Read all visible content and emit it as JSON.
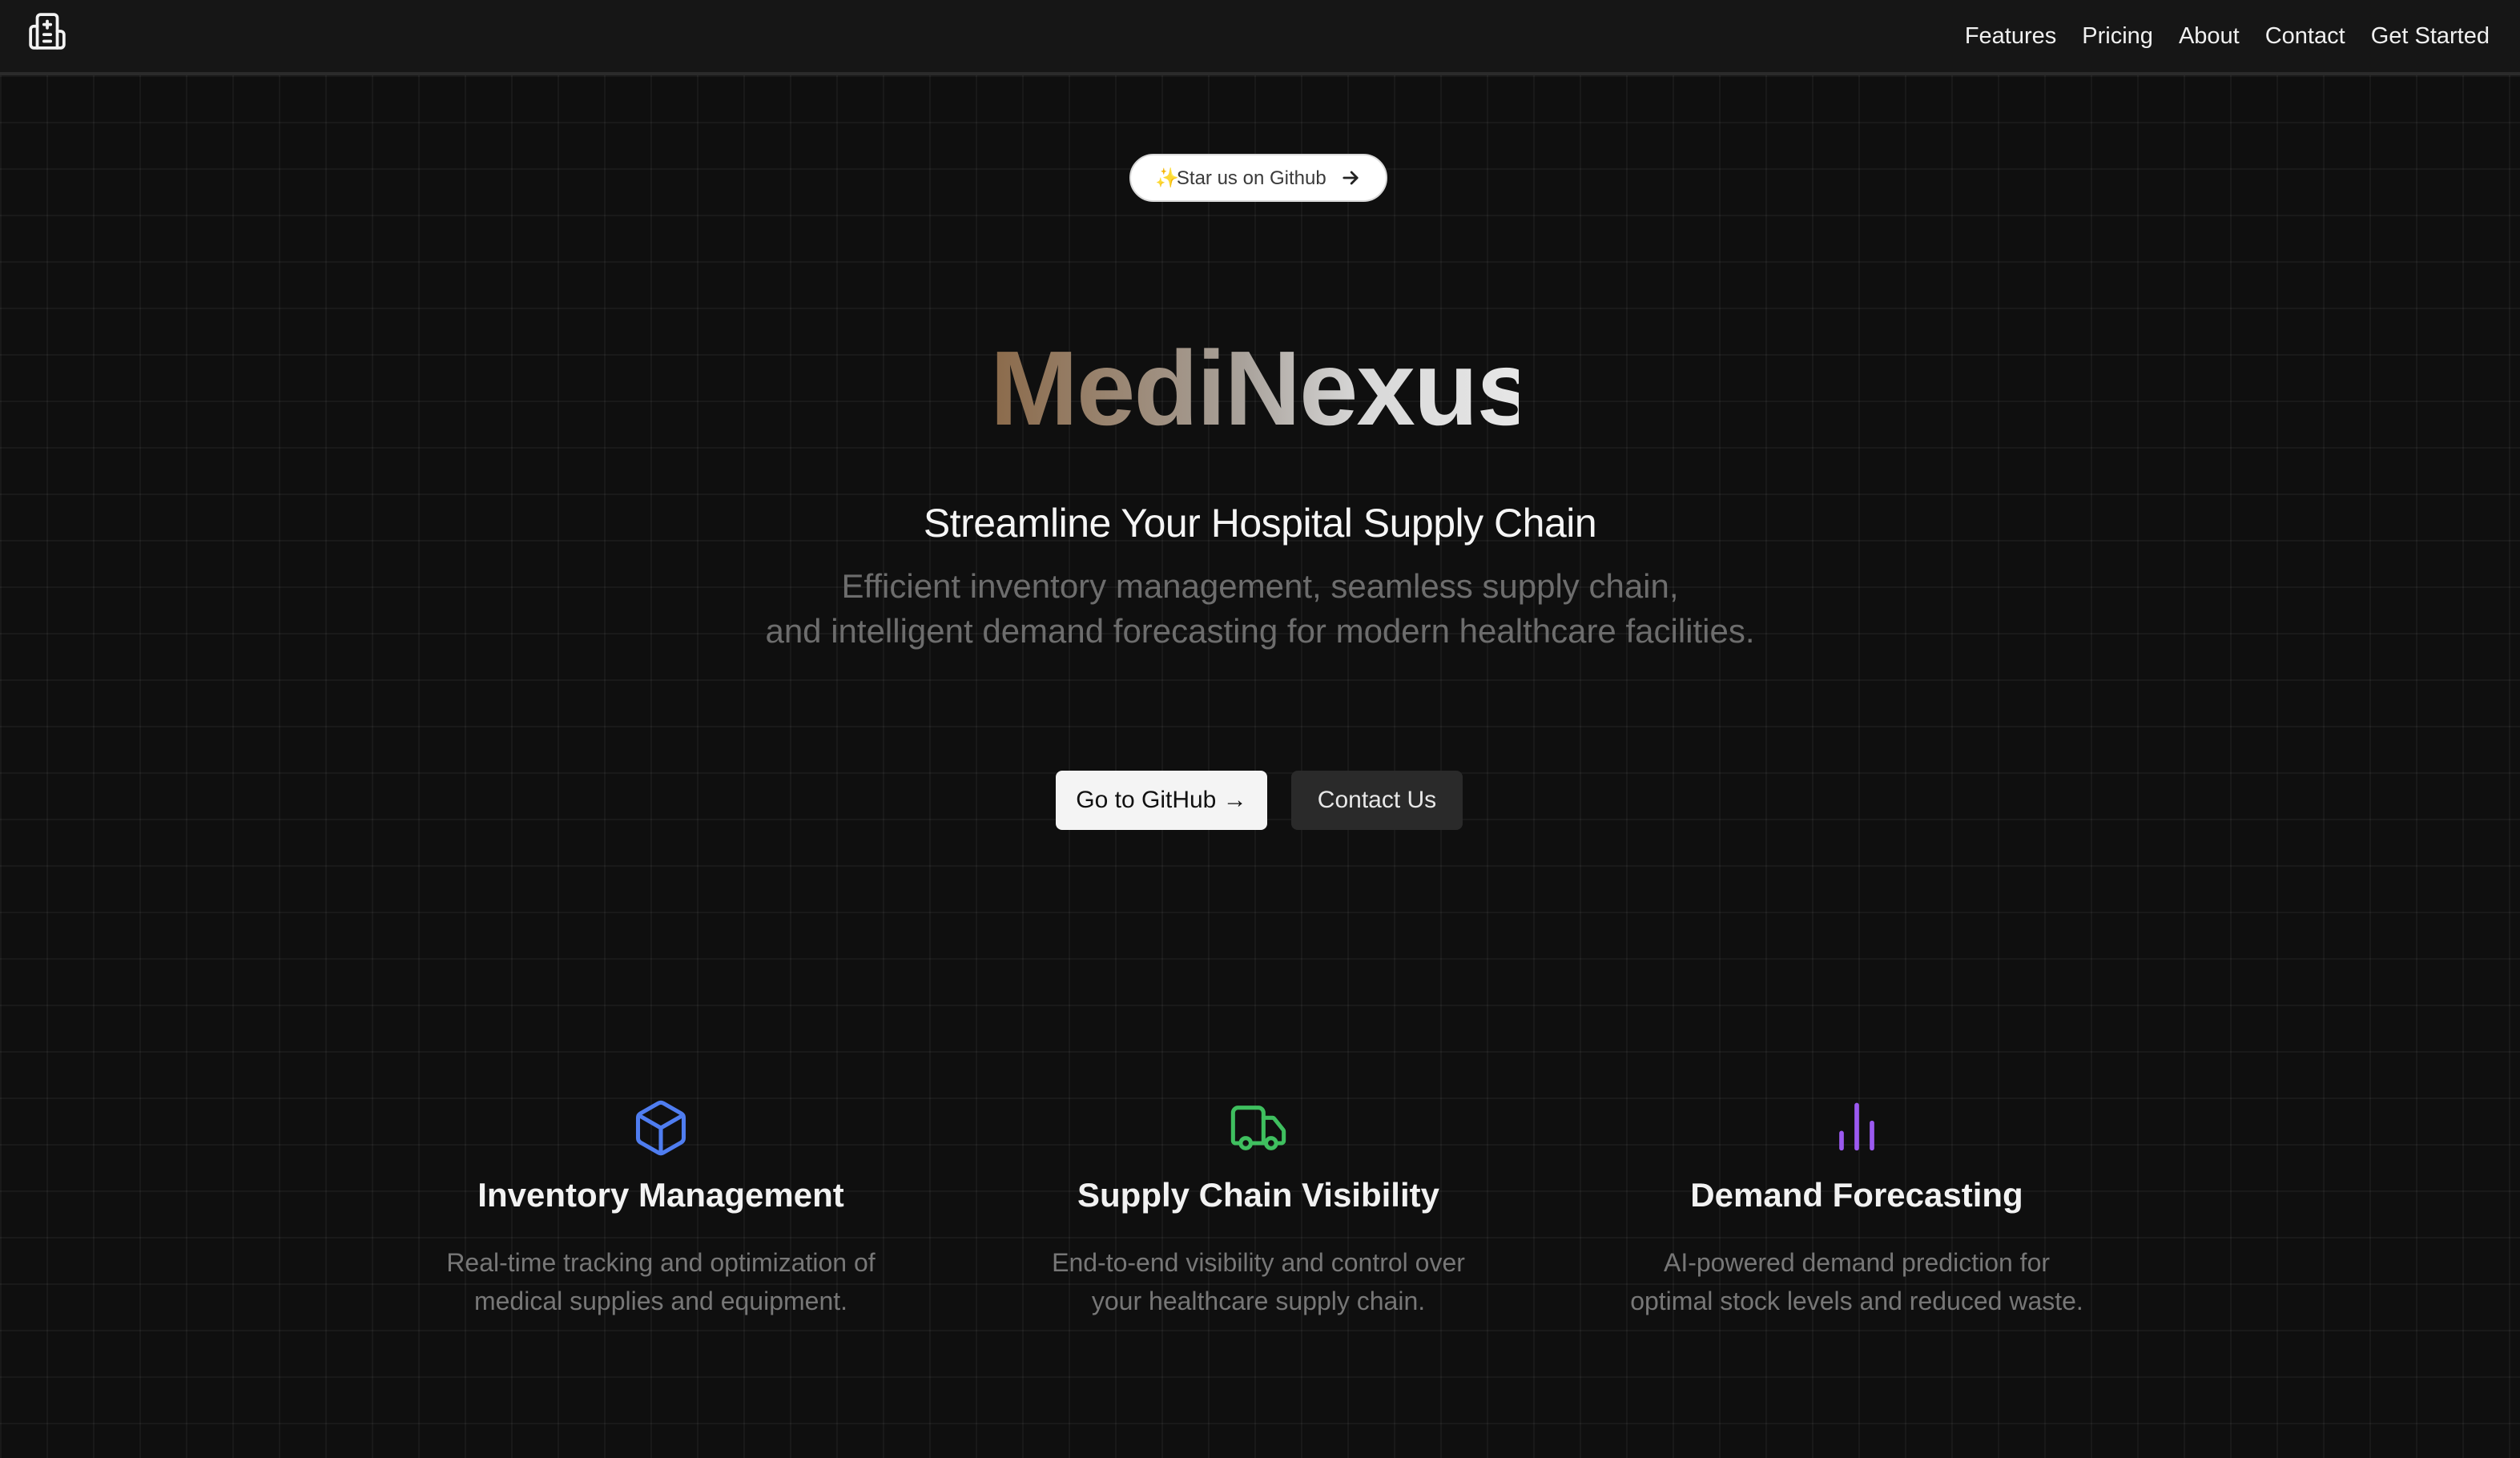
{
  "nav": {
    "logo_icon": "hospital-icon",
    "links": [
      "Features",
      "Pricing",
      "About",
      "Contact",
      "Get Started"
    ]
  },
  "hero": {
    "star_pill": {
      "sparkle": "✨",
      "label": "Star us on Github",
      "icon": "arrow-right-icon"
    },
    "brand": "MediNexus",
    "tagline": "Streamline Your Hospital Supply Chain",
    "subtitle_line1": "Efficient inventory management, seamless supply chain,",
    "subtitle_line2": "and intelligent demand forecasting for modern healthcare facilities.",
    "primary_button": "Go to GitHub →",
    "secondary_button": "Contact Us"
  },
  "features": [
    {
      "icon": "box-icon",
      "color": "#4f7df0",
      "title": "Inventory Management",
      "desc_line1": "Real-time tracking and optimization of",
      "desc_line2": "medical supplies and equipment."
    },
    {
      "icon": "truck-icon",
      "color": "#3fbf5f",
      "title": "Supply Chain Visibility",
      "desc_line1": "End-to-end visibility and control over",
      "desc_line2": "your healthcare supply chain."
    },
    {
      "icon": "bar-chart-icon",
      "color": "#9b59f0",
      "title": "Demand Forecasting",
      "desc_line1": "AI-powered demand prediction for",
      "desc_line2": "optimal stock levels and reduced waste."
    }
  ],
  "colors": {
    "background": "#0f0f0f",
    "navbar": "#161616",
    "brand_gradient_start": "#8b6a4a",
    "brand_gradient_end": "#e6e6e6"
  }
}
